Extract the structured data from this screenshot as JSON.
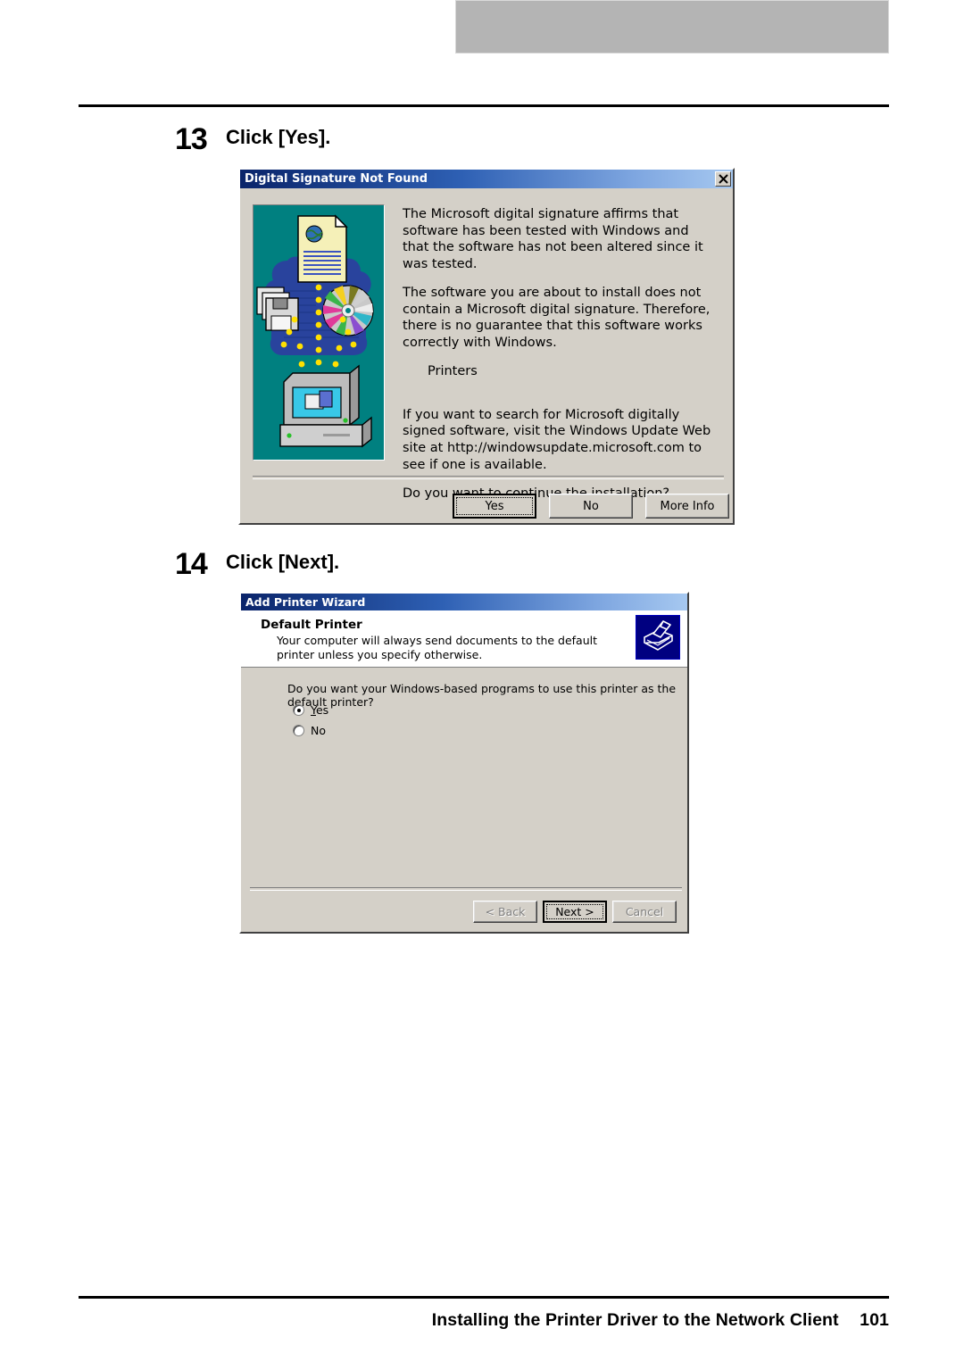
{
  "page": {
    "footer_text": "Installing the Printer Driver to the Network Client",
    "page_number": "101"
  },
  "steps": [
    {
      "number": "13",
      "title": "Click [Yes]."
    },
    {
      "number": "14",
      "title": "Click [Next]."
    }
  ],
  "signature_dialog": {
    "title": "Digital Signature Not Found",
    "close_icon": "close-icon",
    "illustration_bg": "#008080",
    "paragraphs": [
      "The Microsoft digital signature affirms that software has been tested with Windows and that the software has not been altered since it was tested.",
      "The software you are about to install does not contain a Microsoft digital signature. Therefore,  there is no guarantee that this software works correctly with Windows."
    ],
    "subject": "Printers",
    "paragraphs2": [
      "If you want to search for Microsoft digitally signed software, visit the Windows Update Web site at http://windowsupdate.microsoft.com to see if one is available.",
      "Do you want to continue the installation?"
    ],
    "buttons": [
      {
        "label": "Yes",
        "default": true
      },
      {
        "label": "No",
        "default": false
      },
      {
        "label": "More Info",
        "default": false
      }
    ]
  },
  "wizard_dialog": {
    "title": "Add Printer Wizard",
    "header_title": "Default Printer",
    "header_sub": "Your computer will always send documents to the default printer unless you specify otherwise.",
    "header_icon": "printer-icon",
    "question": "Do you want your Windows-based programs to use this printer as the default printer?",
    "radios": [
      {
        "label": "Yes",
        "checked": true
      },
      {
        "label": "No",
        "checked": false
      }
    ],
    "buttons": [
      {
        "label": "< Back",
        "disabled": true,
        "default": false
      },
      {
        "label": "Next >",
        "disabled": false,
        "default": true
      },
      {
        "label": "Cancel",
        "disabled": true,
        "default": false
      }
    ]
  },
  "colors": {
    "titlebar_start": "#0a246a",
    "titlebar_end": "#a6c8f0",
    "dialog_face": "#d4d0c8",
    "illustration": "#008080",
    "wizard_icon": "#000080"
  }
}
